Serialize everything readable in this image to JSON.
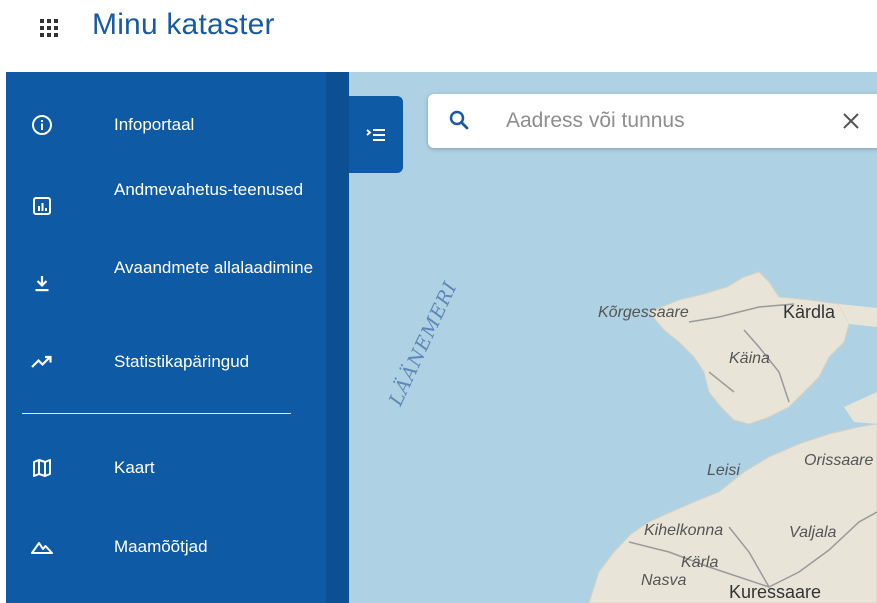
{
  "header": {
    "title": "Minu kataster",
    "apps_icon": "apps-grid-icon"
  },
  "sidebar": {
    "items": [
      {
        "label": "Infoportaal",
        "icon": "info-icon"
      },
      {
        "label": "Andmevahetus-teenused",
        "icon": "bar-chart-icon"
      },
      {
        "label": "Avaandmete allalaadimine",
        "icon": "download-icon"
      },
      {
        "label": "Statistikapäringud",
        "icon": "trending-up-icon"
      },
      {
        "label": "Kaart",
        "icon": "map-icon"
      },
      {
        "label": "Maamõõtjad",
        "icon": "terrain-icon"
      }
    ]
  },
  "search": {
    "placeholder": "Aadress või tunnus"
  },
  "map": {
    "sea_label": "LÄÄNEMERI",
    "labels": [
      "Kõrgessaare",
      "Kärdla",
      "Käina",
      "Leisi",
      "Orissaare",
      "Kihelkonna",
      "Valjala",
      "Kärla",
      "Nasva",
      "Kuressaare"
    ]
  },
  "colors": {
    "sidebar": "#0f5aa5",
    "title": "#1a5aa5",
    "sea": "#aed2e3",
    "land": "#e8e4d8"
  }
}
